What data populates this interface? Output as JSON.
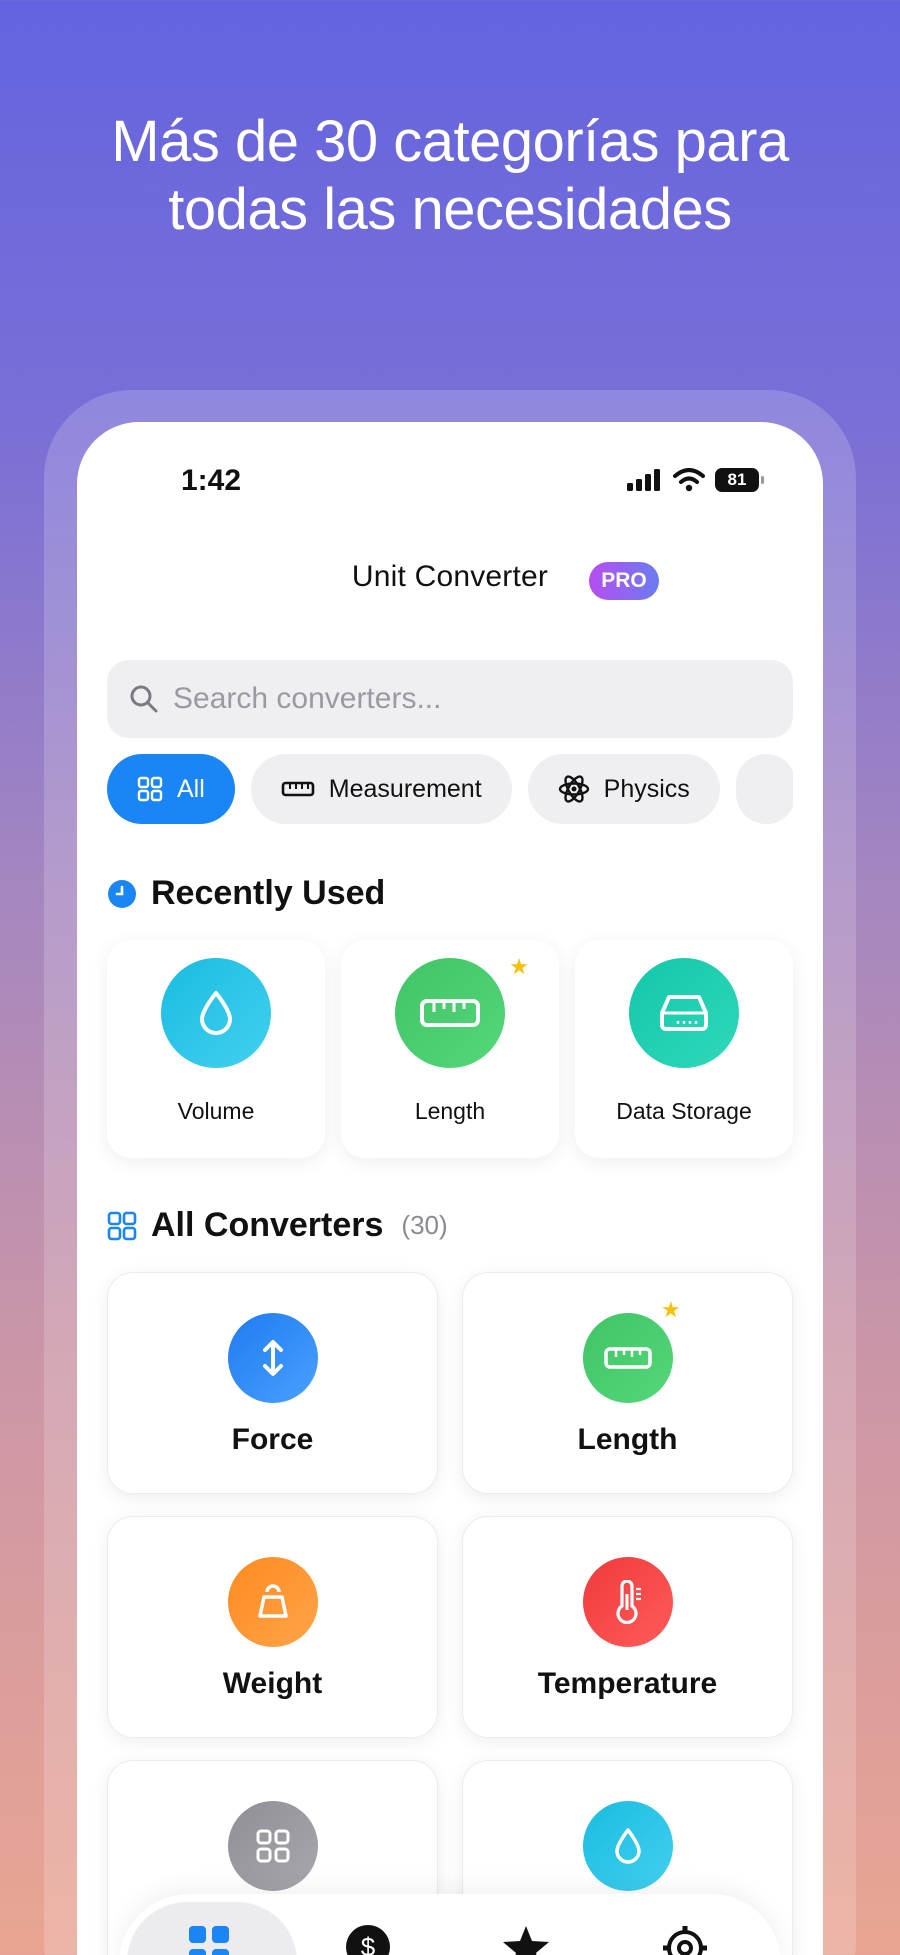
{
  "headline": {
    "line1": "Más de 30 categorías para",
    "line2": "todas las necesidades"
  },
  "status_bar": {
    "time": "1:42",
    "battery": "81"
  },
  "header": {
    "title": "Unit Converter",
    "badge": "PRO"
  },
  "search": {
    "placeholder": "Search converters..."
  },
  "chips": [
    {
      "label": "All",
      "icon": "grid-icon",
      "active": true
    },
    {
      "label": "Measurement",
      "icon": "ruler-icon",
      "active": false
    },
    {
      "label": "Physics",
      "icon": "atom-icon",
      "active": false
    }
  ],
  "recently_used": {
    "title": "Recently Used",
    "items": [
      {
        "label": "Volume",
        "icon": "drop-icon",
        "color": "#19bde0",
        "favorite": false
      },
      {
        "label": "Length",
        "icon": "ruler-icon",
        "color": "#3fc466",
        "favorite": true
      },
      {
        "label": "Data Storage",
        "icon": "drive-icon",
        "color": "#13c7a8",
        "favorite": false
      }
    ]
  },
  "all_converters": {
    "title": "All Converters",
    "count": "(30)",
    "items": [
      {
        "label": "Force",
        "icon": "arrows-vertical-icon",
        "color": "#1f7cf0",
        "favorite": false
      },
      {
        "label": "Length",
        "icon": "ruler-icon",
        "color": "#3fc466",
        "favorite": true
      },
      {
        "label": "Weight",
        "icon": "weight-icon",
        "color": "#ff8a1f",
        "favorite": false
      },
      {
        "label": "Temperature",
        "icon": "thermometer-icon",
        "color": "#f03a3a",
        "favorite": false
      },
      {
        "label": "",
        "icon": "grid-icon",
        "color": "#8f8f95",
        "favorite": false
      },
      {
        "label": "",
        "icon": "drop-icon",
        "color": "#19bde0",
        "favorite": false
      }
    ]
  },
  "tab_bar": {
    "tabs": [
      {
        "icon": "grid-icon",
        "active": true
      },
      {
        "icon": "dollar-icon",
        "active": false
      },
      {
        "icon": "star-icon",
        "active": false
      },
      {
        "icon": "settings-icon",
        "active": false
      }
    ]
  },
  "colors": {
    "accent": "#1a86f5",
    "star": "#f4c20d",
    "pro_gradient_start": "#b84df0",
    "pro_gradient_end": "#6a7cf0"
  }
}
